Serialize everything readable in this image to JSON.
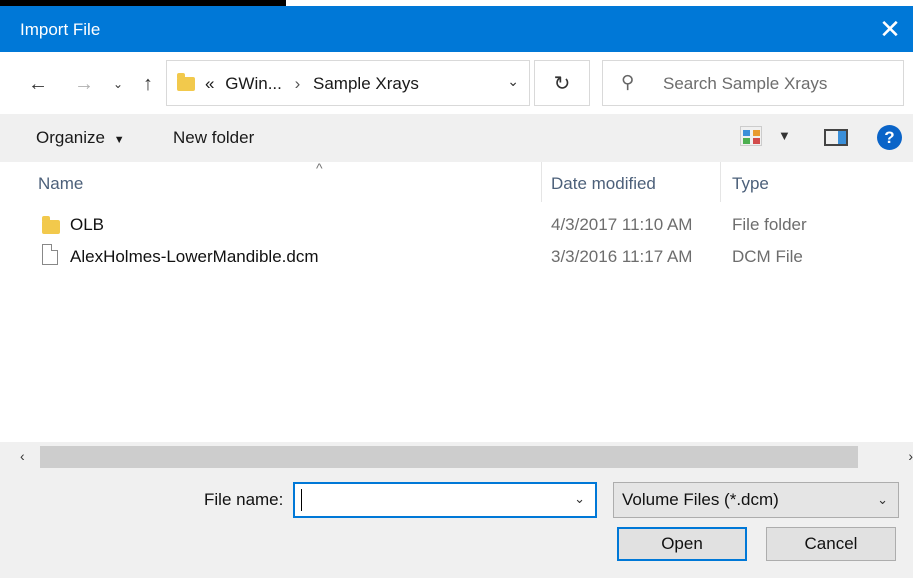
{
  "window": {
    "title": "Import File"
  },
  "navigation": {
    "back_icon": "arrow-left",
    "forward_icon": "arrow-right",
    "recent_icon": "chevron-down",
    "up_icon": "arrow-up",
    "breadcrumb": {
      "overflow": "«",
      "items": [
        "GWin...",
        "Sample Xrays"
      ]
    },
    "refresh_icon": "refresh",
    "search_placeholder": "Search Sample Xrays"
  },
  "toolbar": {
    "organize_label": "Organize",
    "new_folder_label": "New folder"
  },
  "columns": {
    "name": "Name",
    "date_modified": "Date modified",
    "type": "Type"
  },
  "files": [
    {
      "icon": "folder",
      "name": "OLB",
      "date": "4/3/2017 11:10 AM",
      "type": "File folder"
    },
    {
      "icon": "document",
      "name": "AlexHolmes-LowerMandible.dcm",
      "date": "3/3/2016 11:17 AM",
      "type": "DCM File"
    }
  ],
  "footer": {
    "file_name_label": "File name:",
    "file_name_value": "",
    "filter_value": "Volume Files (*.dcm)",
    "open_label": "Open",
    "cancel_label": "Cancel"
  },
  "colors": {
    "titlebar": "#0078d7",
    "accent": "#0078d7",
    "folder": "#f2c94c"
  }
}
